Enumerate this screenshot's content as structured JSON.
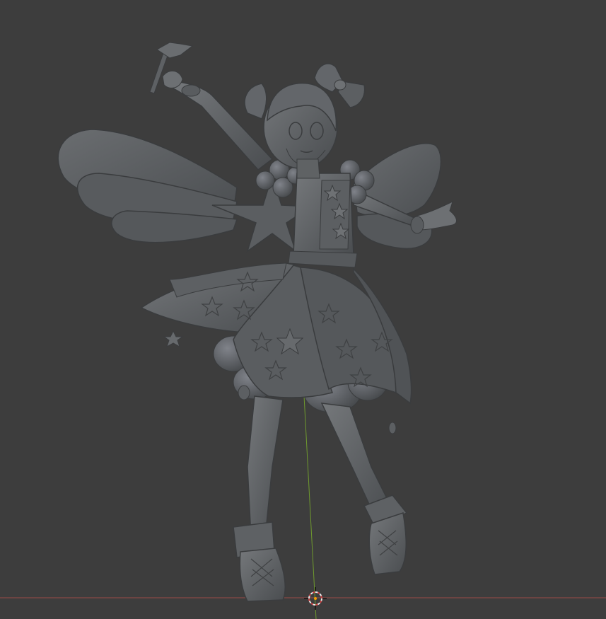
{
  "viewport": {
    "background": "#3d3d3d",
    "model_color": "#5f6264",
    "model_shadow": "#404244",
    "model_highlight": "#7a7d80",
    "x_axis_color": "#9a4a48",
    "y_axis_color": "#6f9a2e"
  },
  "icons": {
    "cursor": "3d-cursor-icon"
  }
}
